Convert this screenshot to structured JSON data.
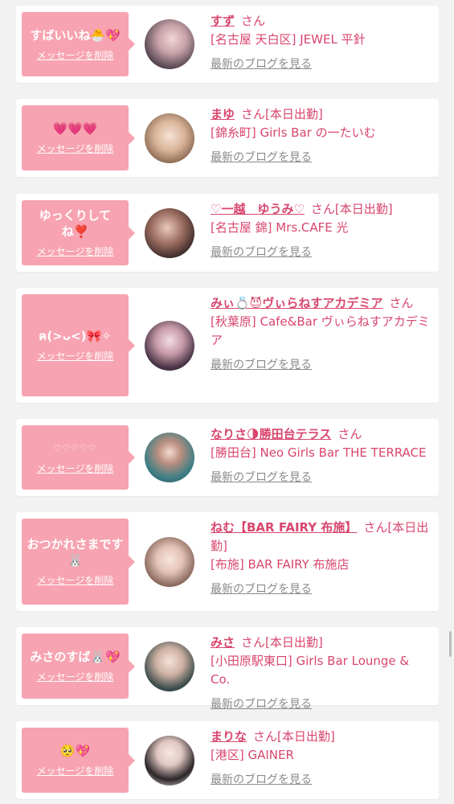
{
  "delete_label": "メッセージを削除",
  "blog_label": "最新のブログを見る",
  "honorific": "さん",
  "cards": [
    {
      "message": "すばいいね🐣💖",
      "name": "すず",
      "tag": "",
      "shop": "[名古屋 天白区] JEWEL 平針"
    },
    {
      "message": "💗💗💗",
      "name": "まゆ",
      "tag": "[本日出勤]",
      "shop": "[錦糸町] Girls Bar の一たいむ"
    },
    {
      "message": "ゆっくりしてね❣️",
      "name": "♡一越　ゆうみ♡",
      "tag": "[本日出勤]",
      "shop": "[名古屋 錦] Mrs.CAFE 光"
    },
    {
      "message": "ฅ(>ᴗ<)🎀✧",
      "name": "みぃ💍😈ヴぃらねすアカデミア",
      "tag": "",
      "shop": "[秋葉原] Cafe&Bar ヴぃらねすアカデミア"
    },
    {
      "message": "♡♡♡♡♡",
      "name": "なりさ🌗勝田台テラス",
      "tag": "",
      "shop": "[勝田台] Neo Girls Bar THE TERRACE"
    },
    {
      "message": "おつかれさまです🐰",
      "name": "ねむ【BAR FAIRY 布施】",
      "tag": "[本日出勤]",
      "shop": "[布施] BAR FAIRY 布施店"
    },
    {
      "message": "みさのすば🐰💖",
      "name": "みさ",
      "tag": "[本日出勤]",
      "shop": "[小田原駅東口] Girls Bar Lounge & Co."
    },
    {
      "message": "🥺💖",
      "name": "まりな",
      "tag": "[本日出勤]",
      "shop": "[港区] GAINER"
    }
  ],
  "colors": {
    "bubble": "#f7a3b1",
    "accent": "#d8466e",
    "link_gray": "#8a8a8a",
    "background": "#f2f2f2"
  }
}
